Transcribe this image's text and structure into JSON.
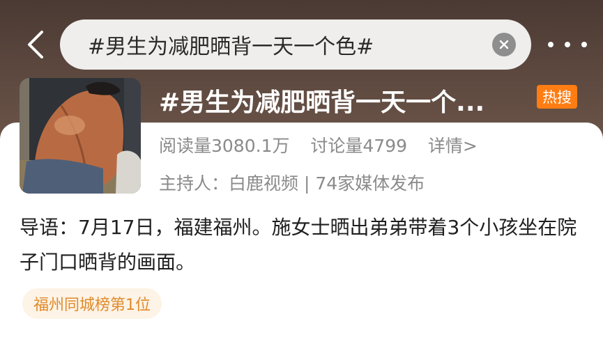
{
  "header": {
    "search_text": "#男生为减肥晒背一天一个色#"
  },
  "topic": {
    "title": "#男生为减肥晒背一天一个...",
    "badge": "热搜",
    "reads": "阅读量3080.1万",
    "discussions": "讨论量4799",
    "details_link": "详情>",
    "host_label": "主持人：",
    "host_name": "白鹿视频",
    "separator": " | ",
    "media_count": "74家媒体发布"
  },
  "intro": {
    "text": "导语：7月17日，福建福州。施女士晒出弟弟带着3个小孩坐在院子门口晒背的画面。"
  },
  "rank_tag": {
    "label": "福州同城榜第1位"
  },
  "colors": {
    "hot_badge": "#ff7d13",
    "rank_tag_text": "#e08a2a",
    "rank_tag_bg": "#fdf3e6"
  }
}
